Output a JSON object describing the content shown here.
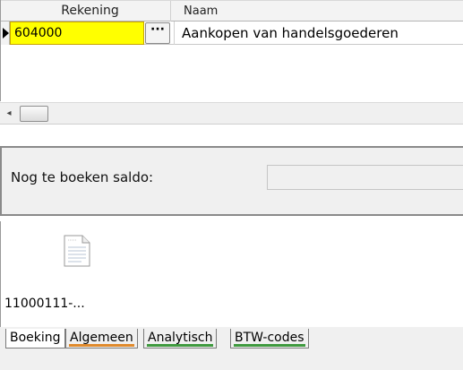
{
  "grid": {
    "columns": {
      "rekening": "Rekening",
      "naam": "Naam"
    },
    "rows": [
      {
        "rekening": "604000",
        "ellipsis": "···",
        "naam": "Aankopen van handelsgoederen"
      }
    ]
  },
  "scrollbar": {
    "left_arrow": "◂"
  },
  "saldo": {
    "label": "Nog te boeken saldo:",
    "value": ""
  },
  "attachment": {
    "file_name": "11000111-..."
  },
  "tabs": [
    {
      "label": "Boeking",
      "active": true,
      "underline": ""
    },
    {
      "label": "Algemeen",
      "active": false,
      "underline": "#e08a2c"
    },
    {
      "label": "Analytisch",
      "active": false,
      "underline": "#3f9a3f"
    },
    {
      "label": "BTW-codes",
      "active": false,
      "underline": "#3f9a3f"
    }
  ],
  "colors": {
    "highlight": "#ffff00",
    "panel": "#f0f0f0"
  }
}
